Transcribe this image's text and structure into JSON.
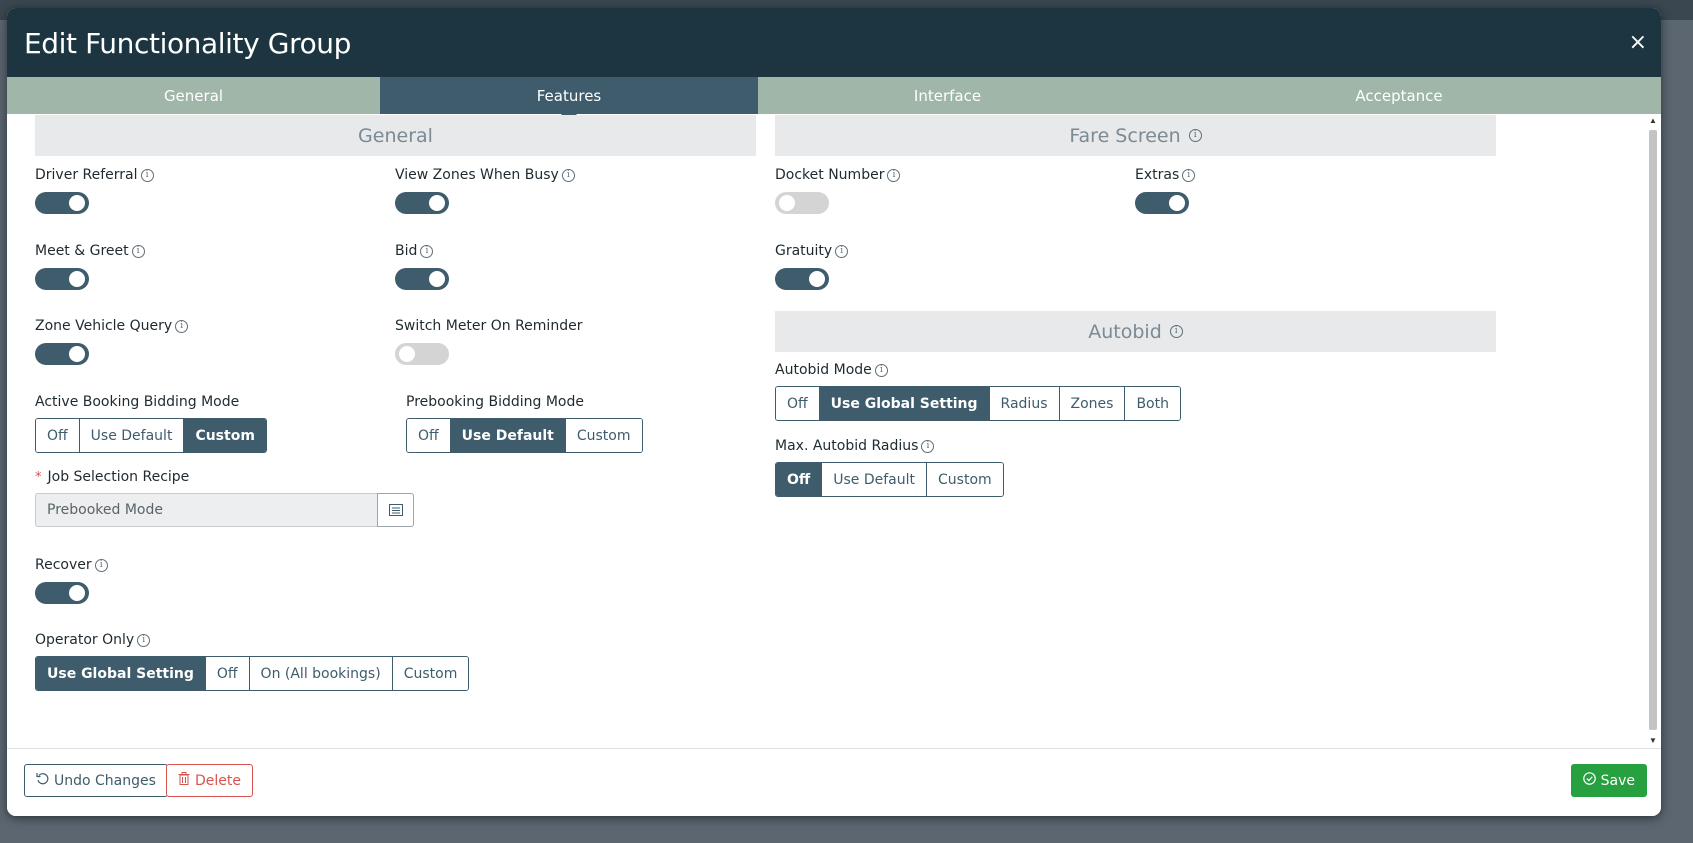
{
  "dialog": {
    "title": "Edit Functionality Group",
    "close": "×"
  },
  "tabs": [
    {
      "label": "General",
      "active": false
    },
    {
      "label": "Features",
      "active": true
    },
    {
      "label": "Interface",
      "active": false
    },
    {
      "label": "Acceptance",
      "active": false
    }
  ],
  "sections": {
    "general": "General",
    "fare_screen": "Fare Screen",
    "autobid": "Autobid"
  },
  "fields": {
    "driver_referral": {
      "label": "Driver Referral",
      "on": true
    },
    "view_zones_when_busy": {
      "label": "View Zones When Busy",
      "on": true
    },
    "meet_greet": {
      "label": "Meet & Greet",
      "on": true
    },
    "bid": {
      "label": "Bid",
      "on": true
    },
    "zone_vehicle_query": {
      "label": "Zone Vehicle Query",
      "on": true
    },
    "switch_meter_on_reminder": {
      "label": "Switch Meter On Reminder",
      "on": false
    },
    "docket_number": {
      "label": "Docket Number",
      "on": false
    },
    "extras": {
      "label": "Extras",
      "on": true
    },
    "gratuity": {
      "label": "Gratuity",
      "on": true
    },
    "recover": {
      "label": "Recover",
      "on": true
    }
  },
  "active_booking_bidding_mode": {
    "label": "Active Booking Bidding Mode",
    "options": [
      "Off",
      "Use Default",
      "Custom"
    ],
    "selected": "Custom"
  },
  "prebooking_bidding_mode": {
    "label": "Prebooking Bidding Mode",
    "options": [
      "Off",
      "Use Default",
      "Custom"
    ],
    "selected": "Use Default"
  },
  "job_selection_recipe": {
    "label": "Job Selection Recipe",
    "required_mark": "*",
    "value": "Prebooked Mode"
  },
  "operator_only": {
    "label": "Operator Only",
    "options": [
      "Use Global Setting",
      "Off",
      "On (All bookings)",
      "Custom"
    ],
    "selected": "Use Global Setting"
  },
  "autobid_mode": {
    "label": "Autobid Mode",
    "options": [
      "Off",
      "Use Global Setting",
      "Radius",
      "Zones",
      "Both"
    ],
    "selected": "Use Global Setting"
  },
  "max_autobid_radius": {
    "label": "Max. Autobid Radius",
    "options": [
      "Off",
      "Use Default",
      "Custom"
    ],
    "selected": "Off"
  },
  "footer": {
    "undo": "Undo Changes",
    "delete": "Delete",
    "save": "Save"
  },
  "info_glyph": "i",
  "colors": {
    "header": "#1c3540",
    "tab_active": "#3e5c6b",
    "tab_inactive": "#9fb6a8",
    "toggle_on": "#3e5c6b",
    "save": "#27a040",
    "delete": "#d9534f"
  }
}
